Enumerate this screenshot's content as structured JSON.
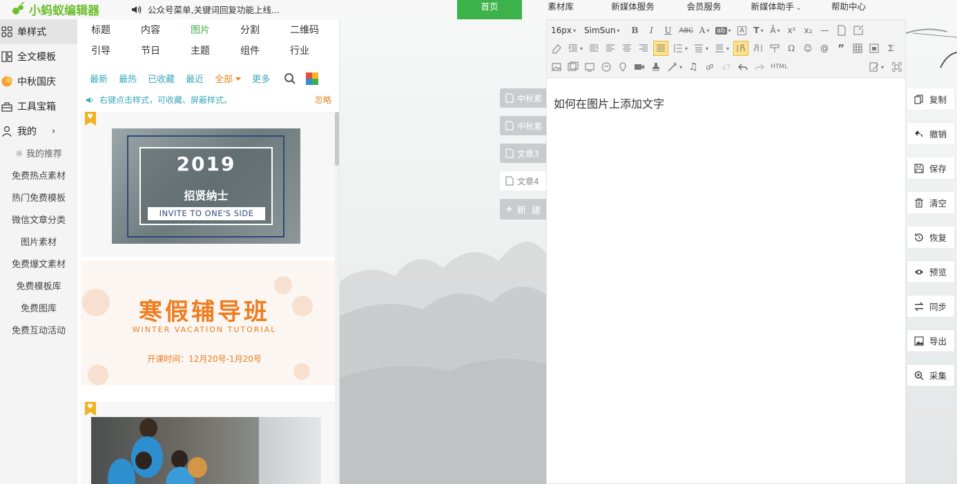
{
  "app": {
    "logo_text": "小蚂蚁编辑器"
  },
  "topbar": {
    "notice": "公众号菜单,关键词回复功能上线...",
    "nav": [
      {
        "label": "首页",
        "active": true
      },
      {
        "label": "素材库"
      },
      {
        "label": "新媒体服务"
      },
      {
        "label": "会员服务"
      },
      {
        "label": "新媒体助手",
        "dropdown": true
      },
      {
        "label": "帮助中心"
      }
    ]
  },
  "sidebar": {
    "main": [
      {
        "label": "单样式",
        "icon": "grid-icon",
        "active": true
      },
      {
        "label": "全文模板",
        "icon": "template-icon"
      },
      {
        "label": "中秋国庆",
        "icon": "moon-icon"
      },
      {
        "label": "工具宝箱",
        "icon": "toolbox-icon"
      },
      {
        "label": "我的",
        "icon": "user-icon"
      }
    ],
    "recommend": "我的推荐",
    "sub": [
      "免费热点素材",
      "热门免费模板",
      "微信文章分类",
      "图片素材",
      "免费爆文素材",
      "免费模板库",
      "免费图库",
      "免费互动活动"
    ]
  },
  "panel": {
    "categories": [
      "标题",
      "内容",
      "图片",
      "分割",
      "二维码",
      "引导",
      "节日",
      "主题",
      "组件",
      "行业"
    ],
    "active_category": "图片",
    "filters": [
      "最新",
      "最热",
      "已收藏",
      "最近",
      "全部",
      "更多"
    ],
    "tip": "右键点击样式，可收藏、屏蔽样式。",
    "ignore": "忽略",
    "cards": {
      "card1": {
        "year": "2019",
        "title": "招贤纳士",
        "subtitle": "INVITE TO ONE'S SIDE"
      },
      "card2": {
        "title": "寒假辅导班",
        "subtitle": "WINTER VACATION TUTORIAL",
        "time": "开课时间：12月20号-1月20号"
      }
    }
  },
  "doc_tabs": [
    {
      "label": "中秋素"
    },
    {
      "label": "中秋素"
    },
    {
      "label": "文章3"
    },
    {
      "label": "文章4",
      "active": true
    }
  ],
  "new_doc": "新 建",
  "editor": {
    "font_size": "16px",
    "font_family": "SimSun",
    "html_label": "HTML",
    "content": "如何在图片上添加文字"
  },
  "actions": [
    "复制",
    "撤销",
    "保存",
    "清空",
    "恢复",
    "预览",
    "同步",
    "导出",
    "采集"
  ],
  "colors": {
    "brand_green": "#3bb34a",
    "accent_orange": "#ef7c1e",
    "link_teal": "#3aa8b8"
  }
}
